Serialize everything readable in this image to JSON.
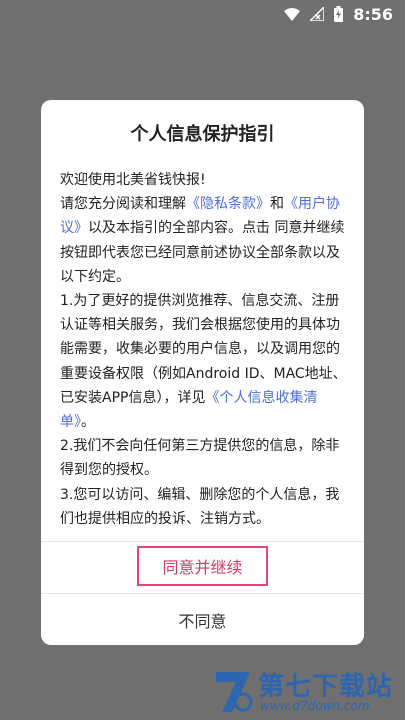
{
  "status_bar": {
    "time": "8:56"
  },
  "dialog": {
    "title": "个人信息保护指引",
    "greeting": "欢迎使用北美省钱快报!",
    "p1_a": "请您充分阅读和理解",
    "privacy_link": "《隐私条款》",
    "p1_b": "和",
    "user_agreement_link": "《用户协议》",
    "p1_c": "以及本指引的全部内容。点击 同意并继续 按钮即代表您已经同意前述协议全部条款以及以下约定。",
    "item1_a": "1.为了更好的提供浏览推荐、信息交流、注册认证等相关服务，我们会根据您使用的具体功能需要，收集必要的用户信息，以及调用您的重要设备权限（例如Android ID、MAC地址、已安装APP信息），详见",
    "info_list_link": "《个人信息收集清单》",
    "item1_b": "。",
    "item2": "2.我们不会向任何第三方提供您的信息，除非得到您的授权。",
    "item3": "3.您可以访问、编辑、删除您的个人信息，我们也提供相应的投诉、注销方式。",
    "agree_label": "同意并继续",
    "disagree_label": "不同意"
  },
  "watermark": {
    "name": "第七下载站",
    "url": "www.d7down.com"
  },
  "colors": {
    "link": "#4d6fd9",
    "agree_border": "#e0487a",
    "agree_text": "#d63b63",
    "watermark": "#2d66b0"
  }
}
